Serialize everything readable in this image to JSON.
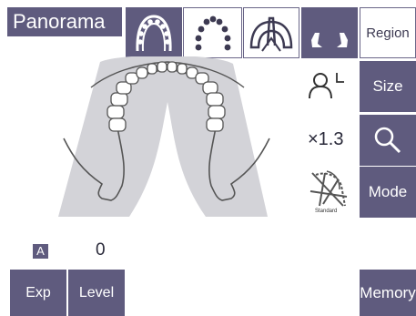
{
  "header": {
    "title": "Panorama"
  },
  "side_buttons": {
    "region": "Region",
    "size": "Size",
    "mode": "Mode",
    "memory": "Memory"
  },
  "bottom_buttons": {
    "exp": "Exp",
    "level": "Level"
  },
  "status": {
    "mode_badge": "A",
    "level_value": "0",
    "magnification": "×1.3",
    "program_label": "Standard"
  },
  "colors": {
    "button": "#5f5b7e",
    "jaw_shadow": "#d3d3d8"
  }
}
